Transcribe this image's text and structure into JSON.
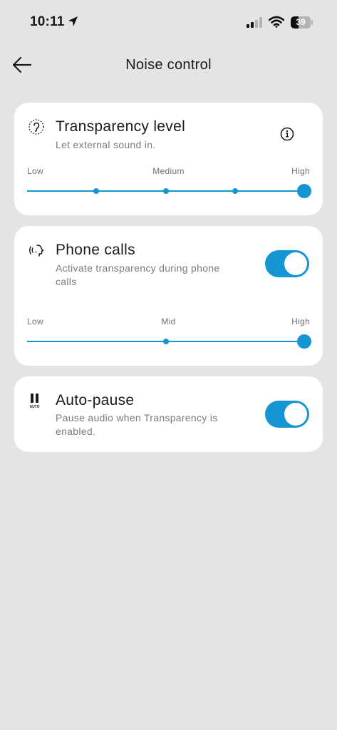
{
  "status_bar": {
    "time": "10:11",
    "battery": "39",
    "battery_level": 0.39,
    "icons": [
      "location-arrow-icon",
      "cellular-signal-icon",
      "wifi-icon",
      "battery-icon"
    ]
  },
  "header": {
    "title": "Noise control",
    "back_icon": "arrow-left-icon"
  },
  "transparency": {
    "icon": "ear-icon",
    "title": "Transparency level",
    "subtitle": "Let external sound in.",
    "info_icon": "info-icon",
    "slider": {
      "labels": {
        "low": "Low",
        "mid": "Medium",
        "high": "High"
      },
      "steps": 5,
      "value_index": 4
    }
  },
  "phone_calls": {
    "icon": "phone-talking-icon",
    "title": "Phone calls",
    "subtitle_line1": "Activate transparency during phone",
    "subtitle_line2": "calls",
    "toggle_on": true,
    "slider": {
      "labels": {
        "low": "Low",
        "mid": "Mid",
        "high": "High"
      },
      "steps": 3,
      "value_index": 2
    }
  },
  "auto_pause": {
    "icon": "pause-auto-icon",
    "icon_caption": "AUTO",
    "title": "Auto-pause",
    "subtitle_line1": "Pause audio when Transparency is",
    "subtitle_line2": "enabled.",
    "toggle_on": true
  },
  "colors": {
    "accent": "#1695d3",
    "background": "#e4e4e4",
    "card": "#ffffff",
    "secondary_text": "#7a7a7a"
  }
}
